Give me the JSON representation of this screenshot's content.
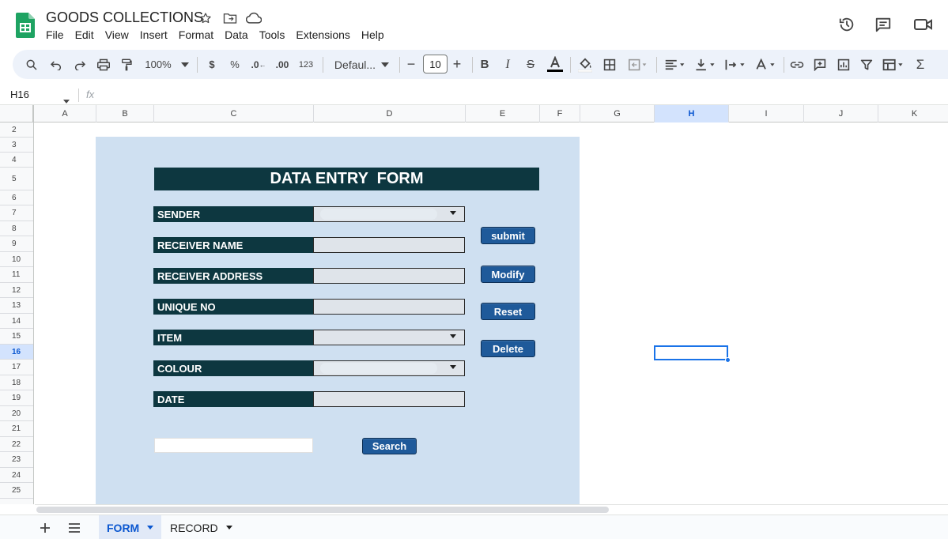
{
  "doc": {
    "title": "GOODS COLLECTIONS",
    "menu": [
      "File",
      "Edit",
      "View",
      "Insert",
      "Format",
      "Data",
      "Tools",
      "Extensions",
      "Help"
    ],
    "icons": [
      "star-icon",
      "move-to-folder-icon",
      "cloud-status-icon",
      "version-history-icon",
      "comments-icon",
      "meet-icon"
    ]
  },
  "toolbar": {
    "zoom": "100%",
    "currency": "$",
    "percent": "%",
    "decrease_decimal": ".0",
    "increase_decimal": ".00",
    "more_formats": "123",
    "font": "Defaul...",
    "font_size": "10"
  },
  "formula_bar": {
    "cell_ref": "H16",
    "fx": "fx",
    "value": ""
  },
  "grid": {
    "columns": [
      "A",
      "B",
      "C",
      "D",
      "E",
      "F",
      "G",
      "H",
      "I",
      "J",
      "K"
    ],
    "selected_column": "H",
    "rows": [
      "2",
      "3",
      "4",
      "5",
      "6",
      "7",
      "8",
      "9",
      "10",
      "11",
      "12",
      "13",
      "14",
      "15",
      "16",
      "17",
      "18",
      "19",
      "20",
      "21",
      "22",
      "23",
      "24",
      "25"
    ],
    "selected_row": "16"
  },
  "form": {
    "title": "DATA ENTRY  FORM",
    "fields": [
      {
        "label": "SENDER",
        "dropdown": true
      },
      {
        "label": "RECEIVER NAME",
        "dropdown": false
      },
      {
        "label": "RECEIVER ADDRESS",
        "dropdown": false
      },
      {
        "label": "UNIQUE NO",
        "dropdown": false
      },
      {
        "label": "ITEM",
        "dropdown": true
      },
      {
        "label": "COLOUR",
        "dropdown": true
      },
      {
        "label": "DATE",
        "dropdown": false
      }
    ],
    "buttons": {
      "submit": "submit",
      "modify": "Modify",
      "reset": "Reset",
      "delete": "Delete",
      "search": "Search"
    }
  },
  "sheets": {
    "tabs": [
      "FORM",
      "RECORD"
    ],
    "active": "FORM"
  },
  "colors": {
    "form_background": "#cfe0f1",
    "label_dark": "#0d3740",
    "button_blue": "#1f5a9a",
    "selection": "#1a73e8"
  }
}
